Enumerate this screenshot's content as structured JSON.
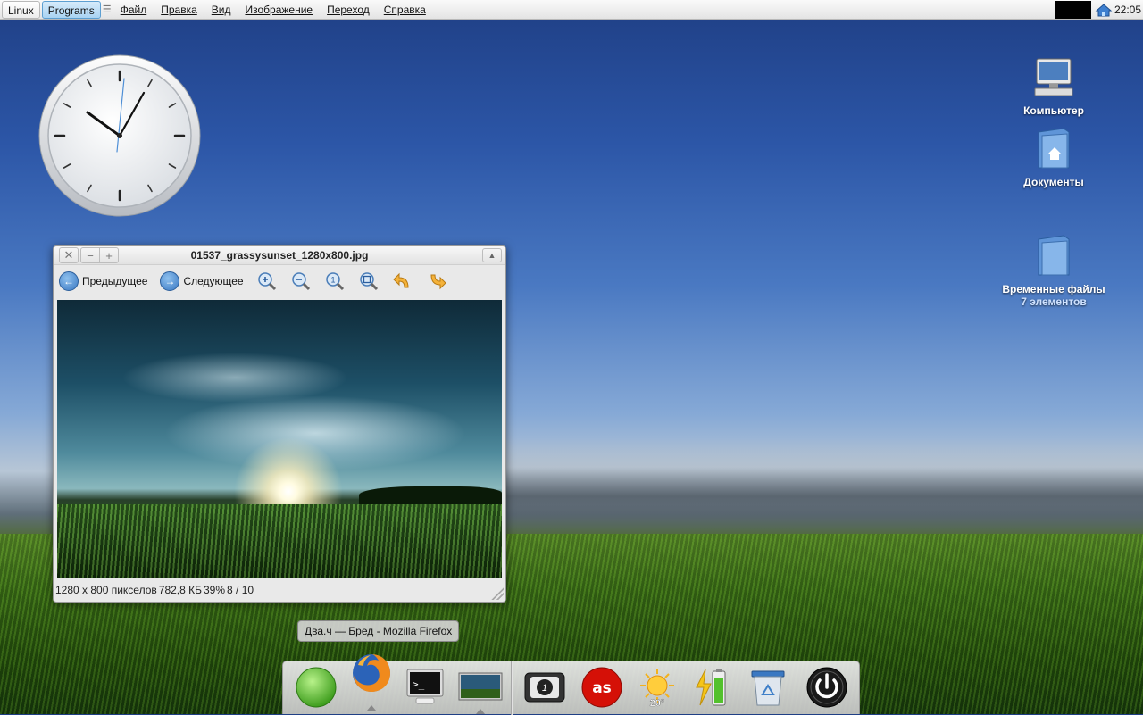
{
  "menubar": {
    "os_button": "Linux",
    "programs_button": "Programs",
    "menu_items": [
      "Файл",
      "Правка",
      "Вид",
      "Изображение",
      "Переход",
      "Справка"
    ],
    "clock": "22:05"
  },
  "desktop_icons": [
    {
      "label": "Компьютер",
      "icon": "computer-icon"
    },
    {
      "label": "Документы",
      "icon": "documents-folder-icon"
    },
    {
      "label": "Временные файлы",
      "sublabel": "7 элементов",
      "icon": "temp-folder-icon"
    }
  ],
  "viewer": {
    "title": "01537_grassysunset_1280x800.jpg",
    "prev_label": "Предыдущее",
    "next_label": "Следующее",
    "tools": [
      "zoom-in-icon",
      "zoom-out-icon",
      "zoom-original-icon",
      "zoom-fit-icon",
      "rotate-left-icon",
      "rotate-right-icon"
    ],
    "status": {
      "dimensions": "1280 x 800 пикселов",
      "filesize": "782,8 КБ",
      "zoom": "39%",
      "position": "8 / 10"
    }
  },
  "tooltip": "Два.ч — Бред - Mozilla Firefox",
  "dock": {
    "items": [
      "green-circle-icon",
      "firefox-icon",
      "terminal-icon",
      "screen-preview-icon",
      "clock-app-icon",
      "lastfm-icon",
      "weather-icon",
      "battery-icon",
      "trash-icon",
      "power-icon"
    ],
    "weather_temp": "20°"
  },
  "colors": {
    "accent": "#5d9fd1",
    "desktop_sky": "#2c56a7",
    "grass": "#3d6e17"
  }
}
